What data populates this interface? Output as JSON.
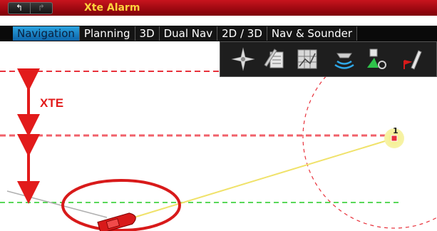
{
  "titlebar": {
    "title": "Xte Alarm",
    "back_glyph": "↰",
    "forward_glyph": "↱"
  },
  "tabs": [
    {
      "label": "Navigation",
      "active": true
    },
    {
      "label": "Planning",
      "active": false
    },
    {
      "label": "3D",
      "active": false
    },
    {
      "label": "Dual Nav",
      "active": false
    },
    {
      "label": "2D / 3D",
      "active": false
    },
    {
      "label": "Nav & Sounder",
      "active": false
    }
  ],
  "toolbar": {
    "tools": [
      {
        "icon": "compass-rose-icon"
      },
      {
        "icon": "edit-notes-icon"
      },
      {
        "icon": "chart-grid-icon"
      },
      {
        "icon": "sonar-boat-icon"
      },
      {
        "icon": "waypoint-goto-icon"
      },
      {
        "icon": "boat-flag-icon"
      }
    ]
  },
  "chart": {
    "xte_label": "XTE",
    "waypoint_label": "1",
    "colors": {
      "xte_line": "#e8323c",
      "green_line": "#22cc22",
      "track": "#f0e26a",
      "arrow": "#e21b1b",
      "boat": "#d81a1a",
      "waypoint_glow": "#f4ef8a"
    }
  }
}
